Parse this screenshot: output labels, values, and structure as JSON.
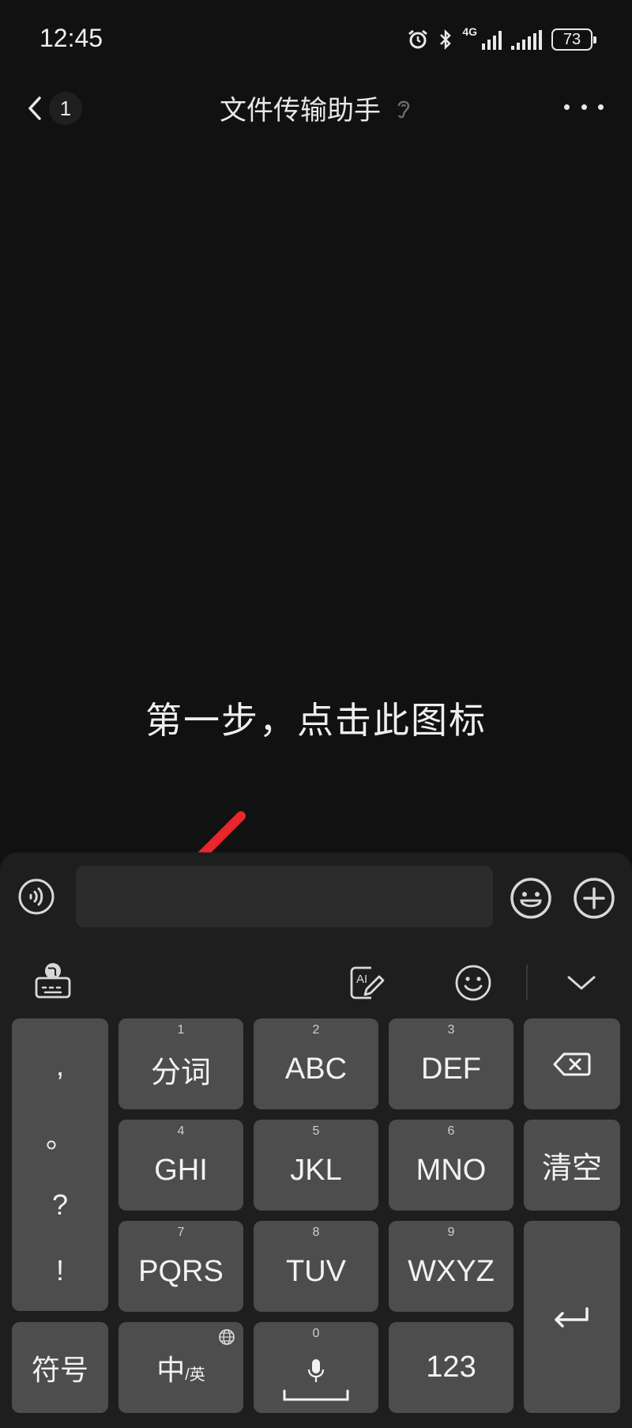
{
  "status_bar": {
    "time": "12:45",
    "network": "4G",
    "battery": "73"
  },
  "header": {
    "unread_count": "1",
    "title": "文件传输助手"
  },
  "annotation": {
    "caption": "第一步，点击此图标"
  },
  "input": {
    "placeholder": ""
  },
  "keyboard": {
    "punctuation": [
      ",",
      "。",
      "?",
      "!"
    ],
    "keys": [
      {
        "num": "1",
        "label": "分词"
      },
      {
        "num": "2",
        "label": "ABC"
      },
      {
        "num": "3",
        "label": "DEF"
      },
      {
        "num": "4",
        "label": "GHI"
      },
      {
        "num": "5",
        "label": "JKL"
      },
      {
        "num": "6",
        "label": "MNO"
      },
      {
        "num": "7",
        "label": "PQRS"
      },
      {
        "num": "8",
        "label": "TUV"
      },
      {
        "num": "9",
        "label": "WXYZ"
      }
    ],
    "clear_label": "清空",
    "symbols_label": "符号",
    "lang_main": "中",
    "lang_sub": "/英",
    "space_num": "0",
    "numbers_label": "123"
  },
  "colors": {
    "arrow": "#e8262b",
    "background": "#111111",
    "key": "#4d4d4d"
  },
  "icons": [
    "back-icon",
    "ear-icon",
    "more-icon",
    "voice-icon",
    "emoji-icon",
    "plus-icon",
    "keyboard-globe-icon",
    "ai-write-icon",
    "smiley-icon",
    "chevron-down-icon",
    "backspace-icon",
    "globe-icon",
    "mic-icon",
    "enter-icon"
  ]
}
